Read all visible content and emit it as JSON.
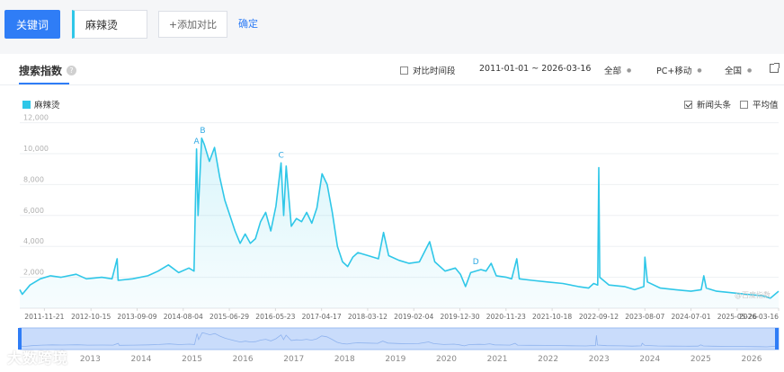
{
  "topbar": {
    "keyword_button": "关键词",
    "keyword_value": "麻辣烫",
    "add_compare": "+添加对比",
    "confirm": "确定"
  },
  "card": {
    "title": "搜索指数",
    "help_icon": "?",
    "compare_period": "对比时间段",
    "date_range": "2011-01-01 ~ 2026-03-16",
    "region_all": "全部",
    "device": "PC+移动",
    "country": "全国",
    "legend_label": "麻辣烫",
    "news_headlines": "新闻头条",
    "average": "平均值",
    "watermark": "@百度指数"
  },
  "colors": {
    "series": "#2fc7e8",
    "accent": "#2f7df6"
  },
  "icons": [
    "help-icon",
    "checkbox-icon",
    "external-link-icon"
  ],
  "footer_watermark": "大数跨境",
  "chart_data": {
    "type": "line",
    "title": "",
    "xlabel": "",
    "ylabel": "",
    "ylim": [
      0,
      12500
    ],
    "yticks": [
      "2,000",
      "4,000",
      "6,000",
      "8,000",
      "10,000",
      "12,000"
    ],
    "yticks_values": [
      2000,
      4000,
      6000,
      8000,
      10000,
      12000
    ],
    "x_tick_labels": [
      "2011-11-21",
      "2012-10-15",
      "2013-09-09",
      "2014-08-04",
      "2015-06-29",
      "2016-05-23",
      "2017-04-17",
      "2018-03-12",
      "2019-02-04",
      "2019-12-30",
      "2020-11-23",
      "2021-10-18",
      "2022-09-12",
      "2023-08-07",
      "2024-07-01",
      "2025-05-26",
      "2026-03-16"
    ],
    "x_tick_years": [
      2011.88,
      2012.79,
      2013.69,
      2014.59,
      2015.49,
      2016.39,
      2017.29,
      2018.19,
      2019.09,
      2019.99,
      2020.89,
      2021.79,
      2022.7,
      2023.6,
      2024.5,
      2025.4,
      2026.21
    ],
    "x_range": [
      2011.4,
      2026.21
    ],
    "grid": true,
    "legend": "top-left",
    "series": [
      {
        "name": "麻辣烫",
        "color": "#2fc7e8",
        "points": [
          [
            2011.4,
            1200
          ],
          [
            2011.45,
            900
          ],
          [
            2011.6,
            1500
          ],
          [
            2011.8,
            1900
          ],
          [
            2012.0,
            2100
          ],
          [
            2012.2,
            2000
          ],
          [
            2012.5,
            2200
          ],
          [
            2012.7,
            1900
          ],
          [
            2013.0,
            2000
          ],
          [
            2013.2,
            1900
          ],
          [
            2013.3,
            3200
          ],
          [
            2013.32,
            1800
          ],
          [
            2013.6,
            1900
          ],
          [
            2013.9,
            2100
          ],
          [
            2014.1,
            2400
          ],
          [
            2014.3,
            2800
          ],
          [
            2014.5,
            2300
          ],
          [
            2014.7,
            2600
          ],
          [
            2014.8,
            2400
          ],
          [
            2014.85,
            10300
          ],
          [
            2014.88,
            6000
          ],
          [
            2014.95,
            11000
          ],
          [
            2015.0,
            10600
          ],
          [
            2015.1,
            9500
          ],
          [
            2015.2,
            10400
          ],
          [
            2015.3,
            8500
          ],
          [
            2015.4,
            7000
          ],
          [
            2015.5,
            6000
          ],
          [
            2015.6,
            5000
          ],
          [
            2015.7,
            4200
          ],
          [
            2015.8,
            4800
          ],
          [
            2015.9,
            4200
          ],
          [
            2016.0,
            4500
          ],
          [
            2016.1,
            5600
          ],
          [
            2016.2,
            6200
          ],
          [
            2016.3,
            5000
          ],
          [
            2016.4,
            6600
          ],
          [
            2016.5,
            9400
          ],
          [
            2016.55,
            6000
          ],
          [
            2016.6,
            9200
          ],
          [
            2016.7,
            5300
          ],
          [
            2016.8,
            5800
          ],
          [
            2016.9,
            5600
          ],
          [
            2017.0,
            6200
          ],
          [
            2017.1,
            5500
          ],
          [
            2017.2,
            6500
          ],
          [
            2017.3,
            8700
          ],
          [
            2017.4,
            8000
          ],
          [
            2017.5,
            6200
          ],
          [
            2017.6,
            4000
          ],
          [
            2017.7,
            3000
          ],
          [
            2017.8,
            2700
          ],
          [
            2017.9,
            3300
          ],
          [
            2018.0,
            3600
          ],
          [
            2018.2,
            3400
          ],
          [
            2018.4,
            3200
          ],
          [
            2018.5,
            4900
          ],
          [
            2018.6,
            3400
          ],
          [
            2018.8,
            3100
          ],
          [
            2019.0,
            2900
          ],
          [
            2019.2,
            3000
          ],
          [
            2019.4,
            4300
          ],
          [
            2019.5,
            3000
          ],
          [
            2019.7,
            2400
          ],
          [
            2019.9,
            2600
          ],
          [
            2020.0,
            2200
          ],
          [
            2020.1,
            1400
          ],
          [
            2020.2,
            2300
          ],
          [
            2020.4,
            2500
          ],
          [
            2020.5,
            2400
          ],
          [
            2020.6,
            2900
          ],
          [
            2020.7,
            2100
          ],
          [
            2020.9,
            2000
          ],
          [
            2021.0,
            1900
          ],
          [
            2021.1,
            3200
          ],
          [
            2021.15,
            1900
          ],
          [
            2021.4,
            1800
          ],
          [
            2021.7,
            1700
          ],
          [
            2022.0,
            1600
          ],
          [
            2022.3,
            1400
          ],
          [
            2022.5,
            1300
          ],
          [
            2022.6,
            1600
          ],
          [
            2022.68,
            1500
          ],
          [
            2022.7,
            9100
          ],
          [
            2022.72,
            2000
          ],
          [
            2022.9,
            1500
          ],
          [
            2023.2,
            1400
          ],
          [
            2023.4,
            1200
          ],
          [
            2023.58,
            1400
          ],
          [
            2023.6,
            3300
          ],
          [
            2023.65,
            1700
          ],
          [
            2023.9,
            1300
          ],
          [
            2024.2,
            1200
          ],
          [
            2024.5,
            1100
          ],
          [
            2024.7,
            1200
          ],
          [
            2024.75,
            2100
          ],
          [
            2024.8,
            1300
          ],
          [
            2025.0,
            1100
          ],
          [
            2025.3,
            1000
          ],
          [
            2025.6,
            900
          ],
          [
            2025.9,
            800
          ],
          [
            2026.05,
            650
          ],
          [
            2026.21,
            1100
          ]
        ]
      }
    ],
    "annotations": [
      {
        "label": "A",
        "x": 2014.85,
        "y": 10300
      },
      {
        "label": "B",
        "x": 2014.97,
        "y": 11000
      },
      {
        "label": "C",
        "x": 2016.5,
        "y": 9400
      },
      {
        "label": "D",
        "x": 2020.3,
        "y": 2500
      }
    ],
    "overview_years": [
      "2013",
      "2014",
      "2015",
      "2016",
      "2017",
      "2018",
      "2019",
      "2020",
      "2021",
      "2022",
      "2023",
      "2024",
      "2025",
      "2026"
    ],
    "overview_year_values": [
      2012.75,
      2013.75,
      2014.75,
      2015.75,
      2016.75,
      2017.75,
      2018.75,
      2019.75,
      2020.75,
      2021.75,
      2022.75,
      2023.75,
      2024.75,
      2025.75
    ]
  }
}
